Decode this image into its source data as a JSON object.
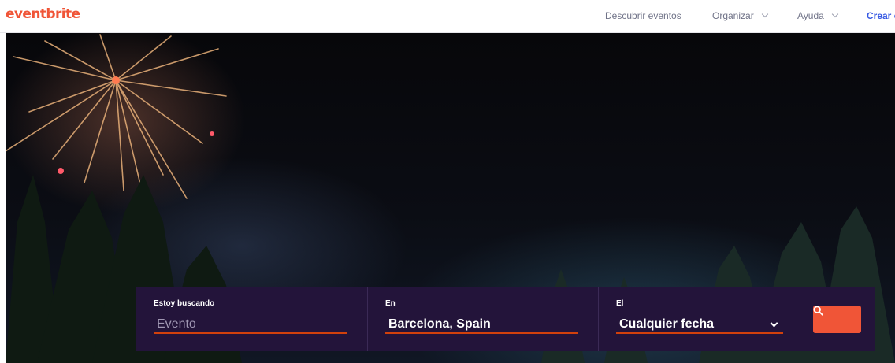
{
  "header": {
    "logo": "eventbrite",
    "nav": {
      "discover": "Descubrir eventos",
      "organize": "Organizar",
      "help": "Ayuda",
      "create": "Crear e"
    }
  },
  "search": {
    "what": {
      "label": "Estoy buscando",
      "placeholder": "Evento"
    },
    "where": {
      "label": "En",
      "value": "Barcelona, Spain"
    },
    "when": {
      "label": "El",
      "value": "Cualquier fecha"
    },
    "button_icon": "search-icon"
  },
  "colors": {
    "brand": "#f05537",
    "create_link": "#3659e3",
    "panel": "#23143a",
    "underline": "#d1410c"
  }
}
